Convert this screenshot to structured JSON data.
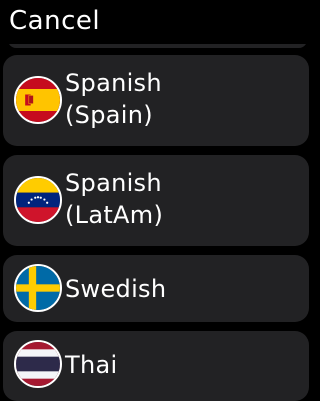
{
  "header": {
    "cancel_label": "Cancel"
  },
  "languages": [
    {
      "line1": "Spanish",
      "line2": "(Spain)",
      "flag": "spain-flag-icon"
    },
    {
      "line1": "Spanish",
      "line2": "(LatAm)",
      "flag": "venezuela-flag-icon"
    },
    {
      "line1": "Swedish",
      "line2": "",
      "flag": "sweden-flag-icon"
    },
    {
      "line1": "Thai",
      "line2": "",
      "flag": "thailand-flag-icon"
    }
  ],
  "colors": {
    "background": "#000000",
    "card": "#222224",
    "text": "#ffffff"
  }
}
